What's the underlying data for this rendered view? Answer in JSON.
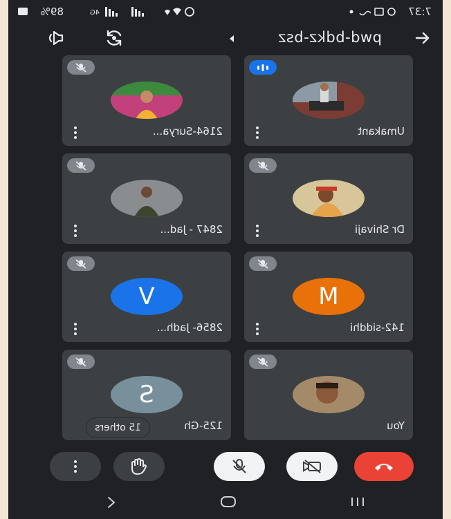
{
  "status_bar": {
    "time": "7:37",
    "battery": "89%",
    "network": "4G"
  },
  "header": {
    "meeting_code": "pwd-bdkz-bsz"
  },
  "tiles": [
    {
      "name": "Umakant",
      "mic": "speaking",
      "avatar": "photo"
    },
    {
      "name": "2164-Surya...",
      "mic": "muted",
      "avatar": "photo"
    },
    {
      "name": "Dr Shivaji",
      "mic": "muted",
      "avatar": "photo"
    },
    {
      "name": "2847 - Jad...",
      "mic": "muted",
      "avatar": "photo"
    },
    {
      "name": "142-siddhi",
      "mic": "muted",
      "avatar": "letter",
      "letter": "M",
      "color": "#e8710a"
    },
    {
      "name": "2856- Jadh...",
      "mic": "muted",
      "avatar": "letter",
      "letter": "V",
      "color": "#1a73e8"
    },
    {
      "name": "You",
      "mic": "muted",
      "avatar": "photo"
    },
    {
      "name": "125-Gh",
      "mic": "muted",
      "avatar": "letter",
      "letter": "S",
      "color": "#78909c"
    }
  ],
  "others_chip": "15 others",
  "controls": {
    "end_call_color": "#ea4335",
    "icons": [
      "end-call-icon",
      "camera-off-icon",
      "mic-off-icon",
      "raise-hand-icon",
      "more-options-icon"
    ]
  },
  "nav": {
    "icons": [
      "recents-icon",
      "home-icon",
      "back-icon"
    ]
  }
}
